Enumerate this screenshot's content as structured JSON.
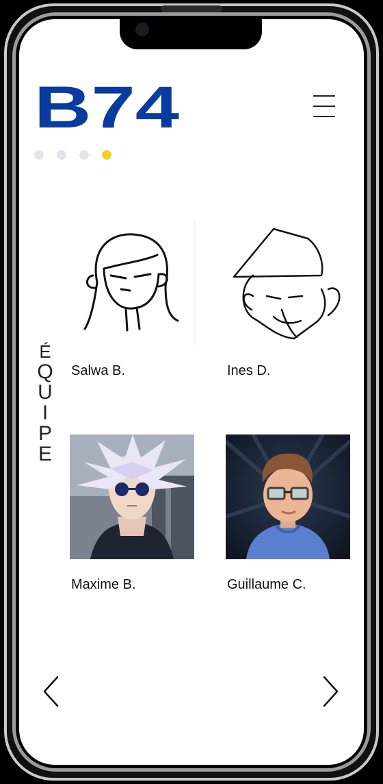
{
  "brand": {
    "logo_text": "B74",
    "accent": "#0a3ca0"
  },
  "carousel": {
    "dot_count": 4,
    "active_index": 3,
    "dot_color": "#e1e5ee",
    "active_color": "#f7cf2b"
  },
  "section": {
    "title_letters": [
      "É",
      "Q",
      "U",
      "I",
      "P",
      "E"
    ]
  },
  "members": [
    {
      "name": "Salwa B.",
      "avatar": "line-drawing-woman"
    },
    {
      "name": "Ines D.",
      "avatar": "line-drawing-caricature"
    },
    {
      "name": "Maxime B.",
      "avatar": "anime-character-photo"
    },
    {
      "name": "Guillaume C.",
      "avatar": "cartoon-avatar"
    }
  ],
  "nav": {
    "prev_icon": "chevron-left-icon",
    "next_icon": "chevron-right-icon",
    "menu_icon": "hamburger-menu-icon"
  }
}
